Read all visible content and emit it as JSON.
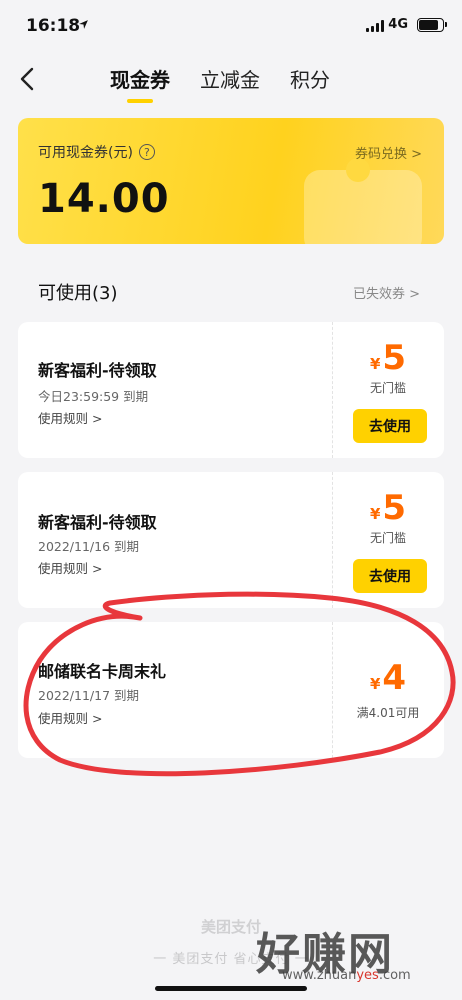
{
  "status_bar": {
    "time": "16:18",
    "network": "4G"
  },
  "nav": {
    "tabs": [
      {
        "label": "现金券",
        "active": true
      },
      {
        "label": "立减金",
        "active": false
      },
      {
        "label": "积分",
        "active": false
      }
    ]
  },
  "cash_card": {
    "label": "可用现金券(元)",
    "amount": "14.00",
    "exchange_link": "券码兑换 >"
  },
  "section": {
    "title": "可使用(3)",
    "expired_link": "已失效券 >"
  },
  "coupons": [
    {
      "name": "新客福利-待领取",
      "expire": "今日23:59:59 到期",
      "rules": "使用规则 >",
      "currency": "¥",
      "value": "5",
      "condition": "无门槛",
      "button": "去使用"
    },
    {
      "name": "新客福利-待领取",
      "expire": "2022/11/16 到期",
      "rules": "使用规则 >",
      "currency": "¥",
      "value": "5",
      "condition": "无门槛",
      "button": "去使用"
    },
    {
      "name": "邮储联名卡周末礼",
      "expire": "2022/11/17 到期",
      "rules": "使用规则 >",
      "currency": "¥",
      "value": "4",
      "condition": "满4.01可用"
    }
  ],
  "footer": {
    "brand": "美团支付",
    "slogan": "一 美团支付 省心支付 一"
  },
  "watermark": {
    "text": "好赚网",
    "url_prefix": "www.zhuan",
    "url_highlight": "yes",
    "url_suffix": ".com"
  },
  "colors": {
    "accent": "#ffd100",
    "price": "#ff6a00",
    "marker": "#e8373c"
  }
}
